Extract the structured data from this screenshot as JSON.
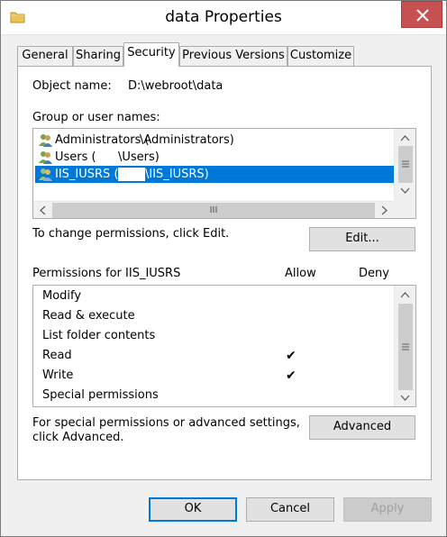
{
  "window": {
    "title": "data Properties",
    "folder_icon": "folder-icon",
    "close_icon": "close-icon"
  },
  "tabs": [
    {
      "label": "General"
    },
    {
      "label": "Sharing"
    },
    {
      "label": "Security",
      "active": true
    },
    {
      "label": "Previous Versions"
    },
    {
      "label": "Customize"
    }
  ],
  "security": {
    "object_name_label": "Object name:",
    "object_name_value": "D:\\webroot\\data",
    "group_label": "Group or user names:",
    "users": [
      {
        "prefix": "Administrators (",
        "suffix": "\\Administrators)",
        "icon": "users-icon"
      },
      {
        "prefix": "Users (",
        "suffix": "\\Users)",
        "icon": "users-icon"
      },
      {
        "prefix": "IIS_IUSRS (",
        "suffix": "\\IIS_IUSRS)",
        "icon": "users-icon",
        "selected": true
      }
    ],
    "change_text": "To change permissions, click Edit.",
    "edit_button": "Edit...",
    "permissions_label": "Permissions for IIS_IUSRS",
    "allow_header": "Allow",
    "deny_header": "Deny",
    "permissions": [
      {
        "name": "Modify",
        "allow": false,
        "deny": false
      },
      {
        "name": "Read & execute",
        "allow": false,
        "deny": false
      },
      {
        "name": "List folder contents",
        "allow": false,
        "deny": false
      },
      {
        "name": "Read",
        "allow": true,
        "deny": false
      },
      {
        "name": "Write",
        "allow": true,
        "deny": false
      },
      {
        "name": "Special permissions",
        "allow": false,
        "deny": false
      }
    ],
    "check_glyph": "✔",
    "advanced_text_line1": "For special permissions or advanced settings,",
    "advanced_text_line2": "click Advanced.",
    "advanced_button": "Advanced",
    "hscroll_thumb_glyph": "III"
  },
  "footer": {
    "ok": "OK",
    "cancel": "Cancel",
    "apply": "Apply"
  },
  "colors": {
    "selection": "#0078d7",
    "close_button": "#c75050"
  }
}
